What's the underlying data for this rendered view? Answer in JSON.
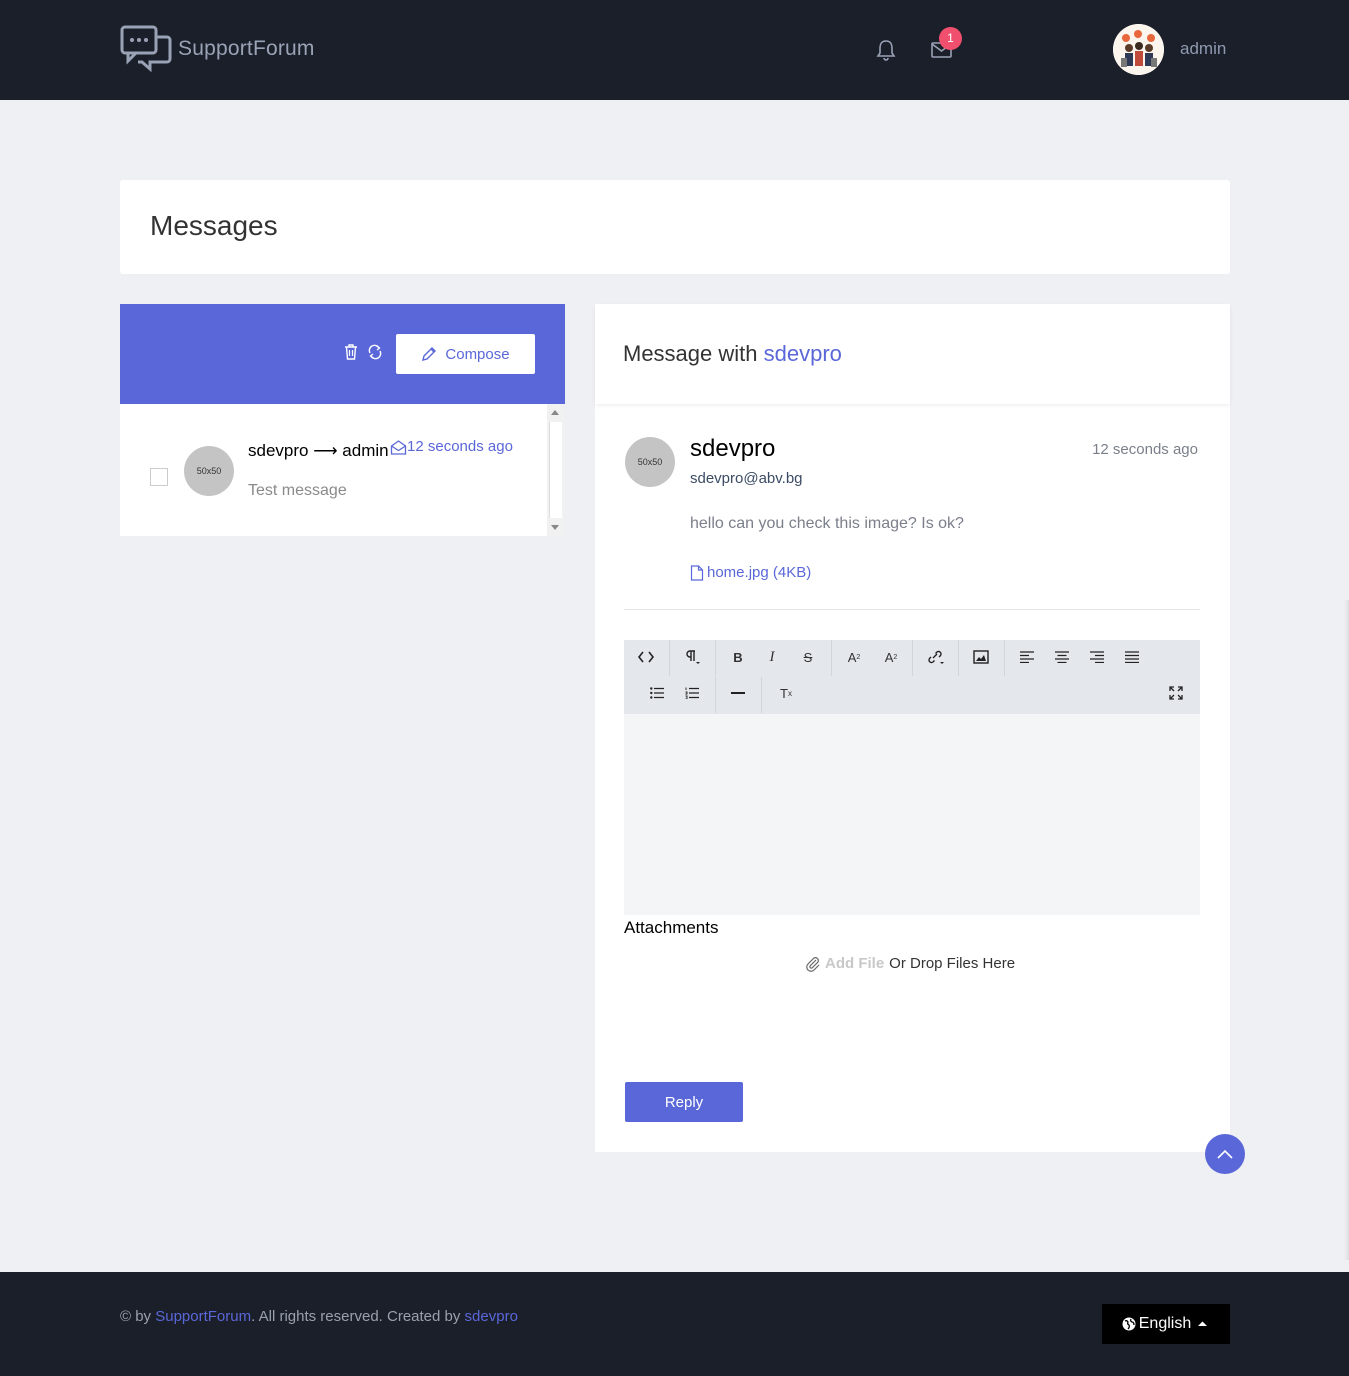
{
  "header": {
    "logo_text": "SupportForum",
    "mail_badge": "1",
    "user_name": "admin"
  },
  "page": {
    "title": "Messages"
  },
  "inbox": {
    "compose_label": "Compose",
    "items": [
      {
        "from_to": "sdevpro ⟶ admin",
        "time": "12 seconds ago",
        "avatar_text": "50x50",
        "preview": "Test message"
      }
    ]
  },
  "conversation": {
    "title_prefix": "Message with",
    "title_user": "sdevpro",
    "message": {
      "avatar_text": "50x50",
      "sender": "sdevpro",
      "email": "sdevpro@abv.bg",
      "time": "12 seconds ago",
      "body": "hello can you check this image? Is ok?",
      "attachment": "home.jpg (4KB)"
    },
    "attachments_label": "Attachments",
    "add_file_label": "Add File",
    "drop_text": "Or Drop Files Here",
    "reply_label": "Reply"
  },
  "footer": {
    "prefix": "© by ",
    "brand": "SupportForum",
    "middle": ". All rights reserved. Created by ",
    "author": "sdevpro",
    "language": "English"
  },
  "colors": {
    "accent": "#5a67d8",
    "topbar": "#1b1f2a",
    "badge": "#f0506e",
    "background": "#eff0f4"
  }
}
